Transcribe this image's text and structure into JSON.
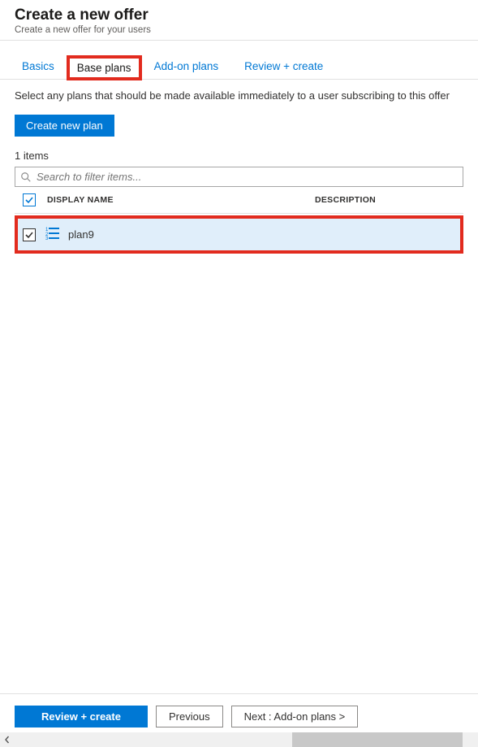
{
  "header": {
    "title": "Create a new offer",
    "subtitle": "Create a new offer for your users"
  },
  "tabs": {
    "basics": "Basics",
    "base_plans": "Base plans",
    "addon_plans": "Add-on plans",
    "review": "Review + create"
  },
  "instruction": "Select any plans that should be made available immediately to a user subscribing to this offer",
  "create_plan_btn": "Create new plan",
  "items_count": "1 items",
  "search_placeholder": "Search to filter items...",
  "columns": {
    "display_name": "DISPLAY NAME",
    "description": "DESCRIPTION"
  },
  "rows": [
    {
      "name": "plan9",
      "checked": true
    }
  ],
  "footer": {
    "review": "Review + create",
    "previous": "Previous",
    "next": "Next : Add-on plans >"
  }
}
